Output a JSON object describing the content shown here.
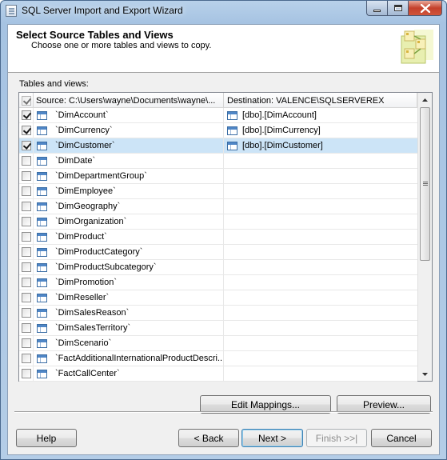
{
  "window": {
    "title": "SQL Server Import and Export Wizard"
  },
  "header": {
    "title": "Select Source Tables and Views",
    "subtitle": "Choose one or more tables and views to copy."
  },
  "grid": {
    "label": "Tables and views:",
    "columns": {
      "source": "Source: C:\\Users\\wayne\\Documents\\wayne\\...",
      "destination": "Destination: VALENCE\\SQLSERVEREX"
    },
    "rows": [
      {
        "source": "`DimAccount`",
        "destination": "[dbo].[DimAccount]",
        "checked": true,
        "selected": false
      },
      {
        "source": "`DimCurrency`",
        "destination": "[dbo].[DimCurrency]",
        "checked": true,
        "selected": false
      },
      {
        "source": "`DimCustomer`",
        "destination": "[dbo].[DimCustomer]",
        "checked": true,
        "selected": true
      },
      {
        "source": "`DimDate`",
        "destination": "",
        "checked": false,
        "selected": false
      },
      {
        "source": "`DimDepartmentGroup`",
        "destination": "",
        "checked": false,
        "selected": false
      },
      {
        "source": "`DimEmployee`",
        "destination": "",
        "checked": false,
        "selected": false
      },
      {
        "source": "`DimGeography`",
        "destination": "",
        "checked": false,
        "selected": false
      },
      {
        "source": "`DimOrganization`",
        "destination": "",
        "checked": false,
        "selected": false
      },
      {
        "source": "`DimProduct`",
        "destination": "",
        "checked": false,
        "selected": false
      },
      {
        "source": "`DimProductCategory`",
        "destination": "",
        "checked": false,
        "selected": false
      },
      {
        "source": "`DimProductSubcategory`",
        "destination": "",
        "checked": false,
        "selected": false
      },
      {
        "source": "`DimPromotion`",
        "destination": "",
        "checked": false,
        "selected": false
      },
      {
        "source": "`DimReseller`",
        "destination": "",
        "checked": false,
        "selected": false
      },
      {
        "source": "`DimSalesReason`",
        "destination": "",
        "checked": false,
        "selected": false
      },
      {
        "source": "`DimSalesTerritory`",
        "destination": "",
        "checked": false,
        "selected": false
      },
      {
        "source": "`DimScenario`",
        "destination": "",
        "checked": false,
        "selected": false
      },
      {
        "source": "`FactAdditionalInternationalProductDescri...",
        "destination": "",
        "checked": false,
        "selected": false
      },
      {
        "source": "`FactCallCenter`",
        "destination": "",
        "checked": false,
        "selected": false
      }
    ]
  },
  "buttons": {
    "edit_mappings": "Edit Mappings...",
    "preview": "Preview...",
    "help": "Help",
    "back": "< Back",
    "next": "Next >",
    "finish": "Finish >>|",
    "cancel": "Cancel"
  },
  "colors": {
    "selected_row": "#cce4f7",
    "title_bar": "#a6c3e2"
  }
}
